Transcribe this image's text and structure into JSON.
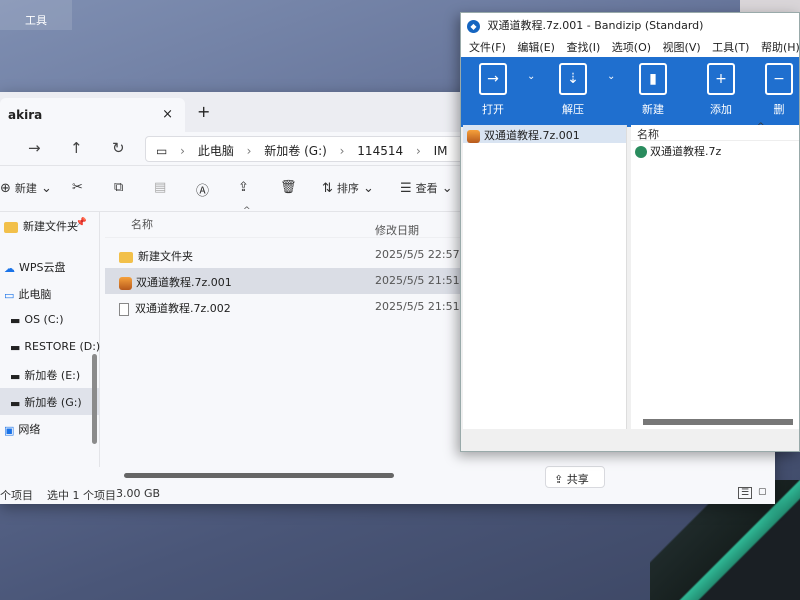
{
  "desktop": {
    "icon_label": "工具"
  },
  "explorer": {
    "tab_title": "akira",
    "tab_close": "×",
    "tab_add": "+",
    "breadcrumbs": [
      "此电脑",
      "新加卷 (G:)",
      "114514",
      "IM"
    ],
    "toolbar": {
      "new": "新建",
      "sort": "排序",
      "view": "查看"
    },
    "nav_items": [
      {
        "label": "新建文件夹",
        "icon": "folder-icon"
      },
      {
        "label": "WPS云盘",
        "icon": "cloud-icon"
      },
      {
        "label": "此电脑",
        "icon": "computer-icon"
      },
      {
        "label": "OS (C:)",
        "icon": "drive-icon"
      },
      {
        "label": "RESTORE (D:)",
        "icon": "drive-icon"
      },
      {
        "label": "新加卷 (E:)",
        "icon": "drive-icon"
      },
      {
        "label": "新加卷 (G:)",
        "icon": "drive-icon"
      },
      {
        "label": "网络",
        "icon": "network-icon"
      }
    ],
    "columns": {
      "name": "名称",
      "modified": "修改日期"
    },
    "files": [
      {
        "name": "新建文件夹",
        "date": "2025/5/5 22:57",
        "type": "folder"
      },
      {
        "name": "双通道教程.7z.001",
        "date": "2025/5/5 21:51",
        "type": "archive",
        "selected": true
      },
      {
        "name": "双通道教程.7z.002",
        "date": "2025/5/5 21:51",
        "type": "file"
      }
    ],
    "share_label": "共享",
    "status": {
      "items": "个项目",
      "selected": "选中 1 个项目",
      "size": "3.00 GB"
    }
  },
  "bandizip": {
    "title": "双通道教程.7z.001 - Bandizip (Standard)",
    "menu": [
      "文件(F)",
      "编辑(E)",
      "查找(I)",
      "选项(O)",
      "视图(V)",
      "工具(T)",
      "帮助(H)"
    ],
    "ribbon": [
      "打开",
      "解压",
      "新建",
      "添加",
      "删"
    ],
    "tree_item": "双通道教程.7z.001",
    "column_name": "名称",
    "list_item": "双通道教程.7z",
    "accent": "#1f6fcf"
  }
}
